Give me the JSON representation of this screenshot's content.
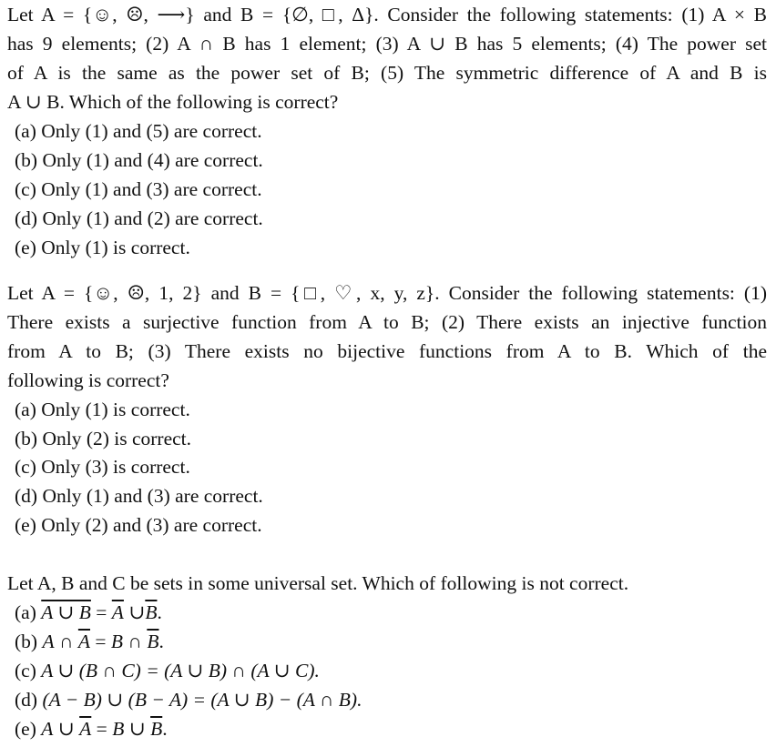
{
  "questions": [
    {
      "stem_lines": [
        "Let A = {☺, ☹, ⟶} and B = {∅, □, Δ}. Consider the following statements: (1) A × B",
        "has 9 elements; (2) A ∩ B has 1 element; (3) A ∪ B has 5 elements; (4) The power set",
        "of A is the same as the power set of B; (5) The symmetric difference of A and B is",
        "A ∪ B. Which of the following is correct?"
      ],
      "options": [
        "(a) Only (1) and (5) are correct.",
        "(b) Only (1) and (4) are correct.",
        "(c) Only (1) and (3) are correct.",
        "(d) Only (1) and (2) are correct.",
        "(e) Only (1) is correct."
      ]
    },
    {
      "stem_lines": [
        "Let A = {☺, ☹, 1, 2} and B = {□, ♡, x, y, z}. Consider the following statements: (1)",
        "There exists a surjective function from A to B; (2) There exists an injective function",
        "from A to B; (3) There exists no bijective functions from A to B. Which of the",
        "following is correct?"
      ],
      "options": [
        "(a) Only (1) is correct.",
        "(b) Only (2) is correct.",
        "(c) Only (3) is correct.",
        "(d) Only (1) and (3) are correct.",
        "(e) Only (2) and (3) are correct."
      ]
    },
    {
      "stem_lines": [
        "Let A, B and C be sets in some universal set. Which of following is not correct."
      ],
      "options": [
        {
          "label": "(a)",
          "lhs_overlined": "A ∪ B",
          "rhs_parts": [
            "A",
            "∪",
            "B"
          ],
          "text": "(a) A∪B (overlined) = Ā ∪ B̄."
        },
        {
          "label": "(b)",
          "text": "(b) A ∩ Ā = B ∩ B̄."
        },
        {
          "label": "(c)",
          "text": "(c) A ∪ (B ∩ C) = (A ∪ B) ∩ (A ∪ C)."
        },
        {
          "label": "(d)",
          "text": "(d) (A − B) ∪ (B − A) = (A ∪ B) − (A ∩ B)."
        },
        {
          "label": "(e)",
          "text": "(e) A ∪ Ā = B ∪ B̄."
        }
      ]
    }
  ],
  "q3_parts": {
    "a": {
      "label": "(a)",
      "lhs": "A ∪ B",
      "eq": "=",
      "r1": "A",
      "op": "∪",
      "r2": "B",
      "end": "."
    },
    "b": {
      "label": "(b)",
      "l1": "A",
      "op1": "∩",
      "l2": "A",
      "eq": "=",
      "r1": "B",
      "op2": "∩",
      "r2": "B",
      "end": "."
    },
    "c": {
      "label": "(c)",
      "expr": "A ∪ (B ∩ C) = (A ∪ B) ∩ (A ∪ C)."
    },
    "d": {
      "label": "(d)",
      "expr": "(A − B) ∪ (B − A) = (A ∪ B) − (A ∩ B)."
    },
    "e": {
      "label": "(e)",
      "l1": "A",
      "op1": "∪",
      "l2": "A",
      "eq": "=",
      "r1": "B",
      "op2": "∪",
      "r2": "B",
      "end": "."
    }
  }
}
